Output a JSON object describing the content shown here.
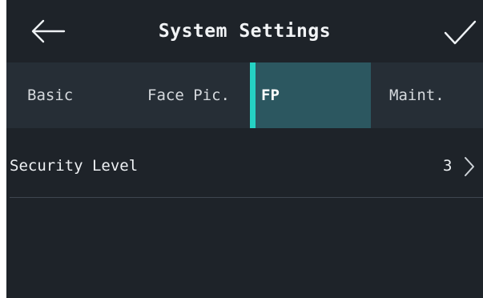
{
  "header": {
    "title": "System Settings",
    "back_icon": "arrow-left-icon",
    "confirm_icon": "check-icon"
  },
  "tabs": [
    {
      "label": "Basic",
      "selected": false
    },
    {
      "label": "Face Pic.",
      "selected": false
    },
    {
      "label": "FP",
      "selected": true
    },
    {
      "label": "Maint.",
      "selected": false
    }
  ],
  "settings": {
    "security_level": {
      "label": "Security Level",
      "value": "3"
    }
  },
  "colors": {
    "background": "#1e2329",
    "tab_bar": "#262e36",
    "tab_selected": "#2c5760",
    "accent": "#25d2c3",
    "text": "#eef1f4"
  }
}
